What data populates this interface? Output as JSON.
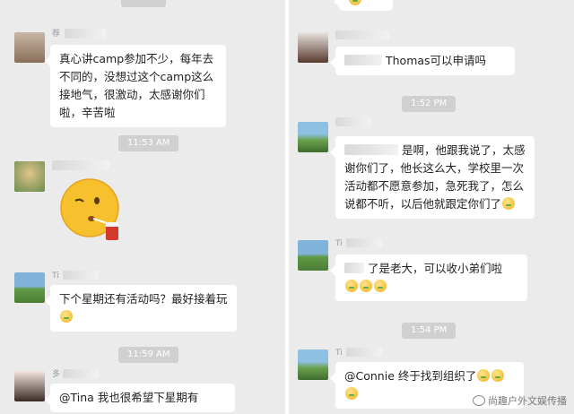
{
  "left": {
    "messages": [
      {
        "sender": "荐",
        "text": "真心讲camp参加不少，每年去不同的，没想过这个camp这么接地气，很激动，太感谢你们啦，辛苦啦"
      },
      {
        "time": "11:53 AM"
      },
      {
        "sender": "",
        "sticker": "face-drinking-sticker"
      },
      {
        "sender": "Ti",
        "text": "下个星期还有活动吗？最好接着玩"
      },
      {
        "time": "11:59 AM"
      },
      {
        "sender": "多",
        "text": "@Tina 我也很希望下星期有"
      }
    ]
  },
  "right": {
    "messages": [
      {
        "text": "Thomas可以申请吗"
      },
      {
        "time": "1:52 PM"
      },
      {
        "text": "是啊，他跟我说了，太感谢你们了，他长这么大，学校里一次活动都不愿意参加，急死我了，怎么说都不听，以后他就跟定你们了"
      },
      {
        "sender": "Ti",
        "text": "了是老大，可以收小弟们啦"
      },
      {
        "time": "1:54 PM"
      },
      {
        "sender": "Ti",
        "text": "@Connie 终于找到组织了"
      }
    ]
  },
  "watermark": "尚趣户外文娱传播",
  "colors": {
    "background": "#ebebeb",
    "bubble": "#ffffff",
    "timestamp": "#d0d0d0"
  }
}
